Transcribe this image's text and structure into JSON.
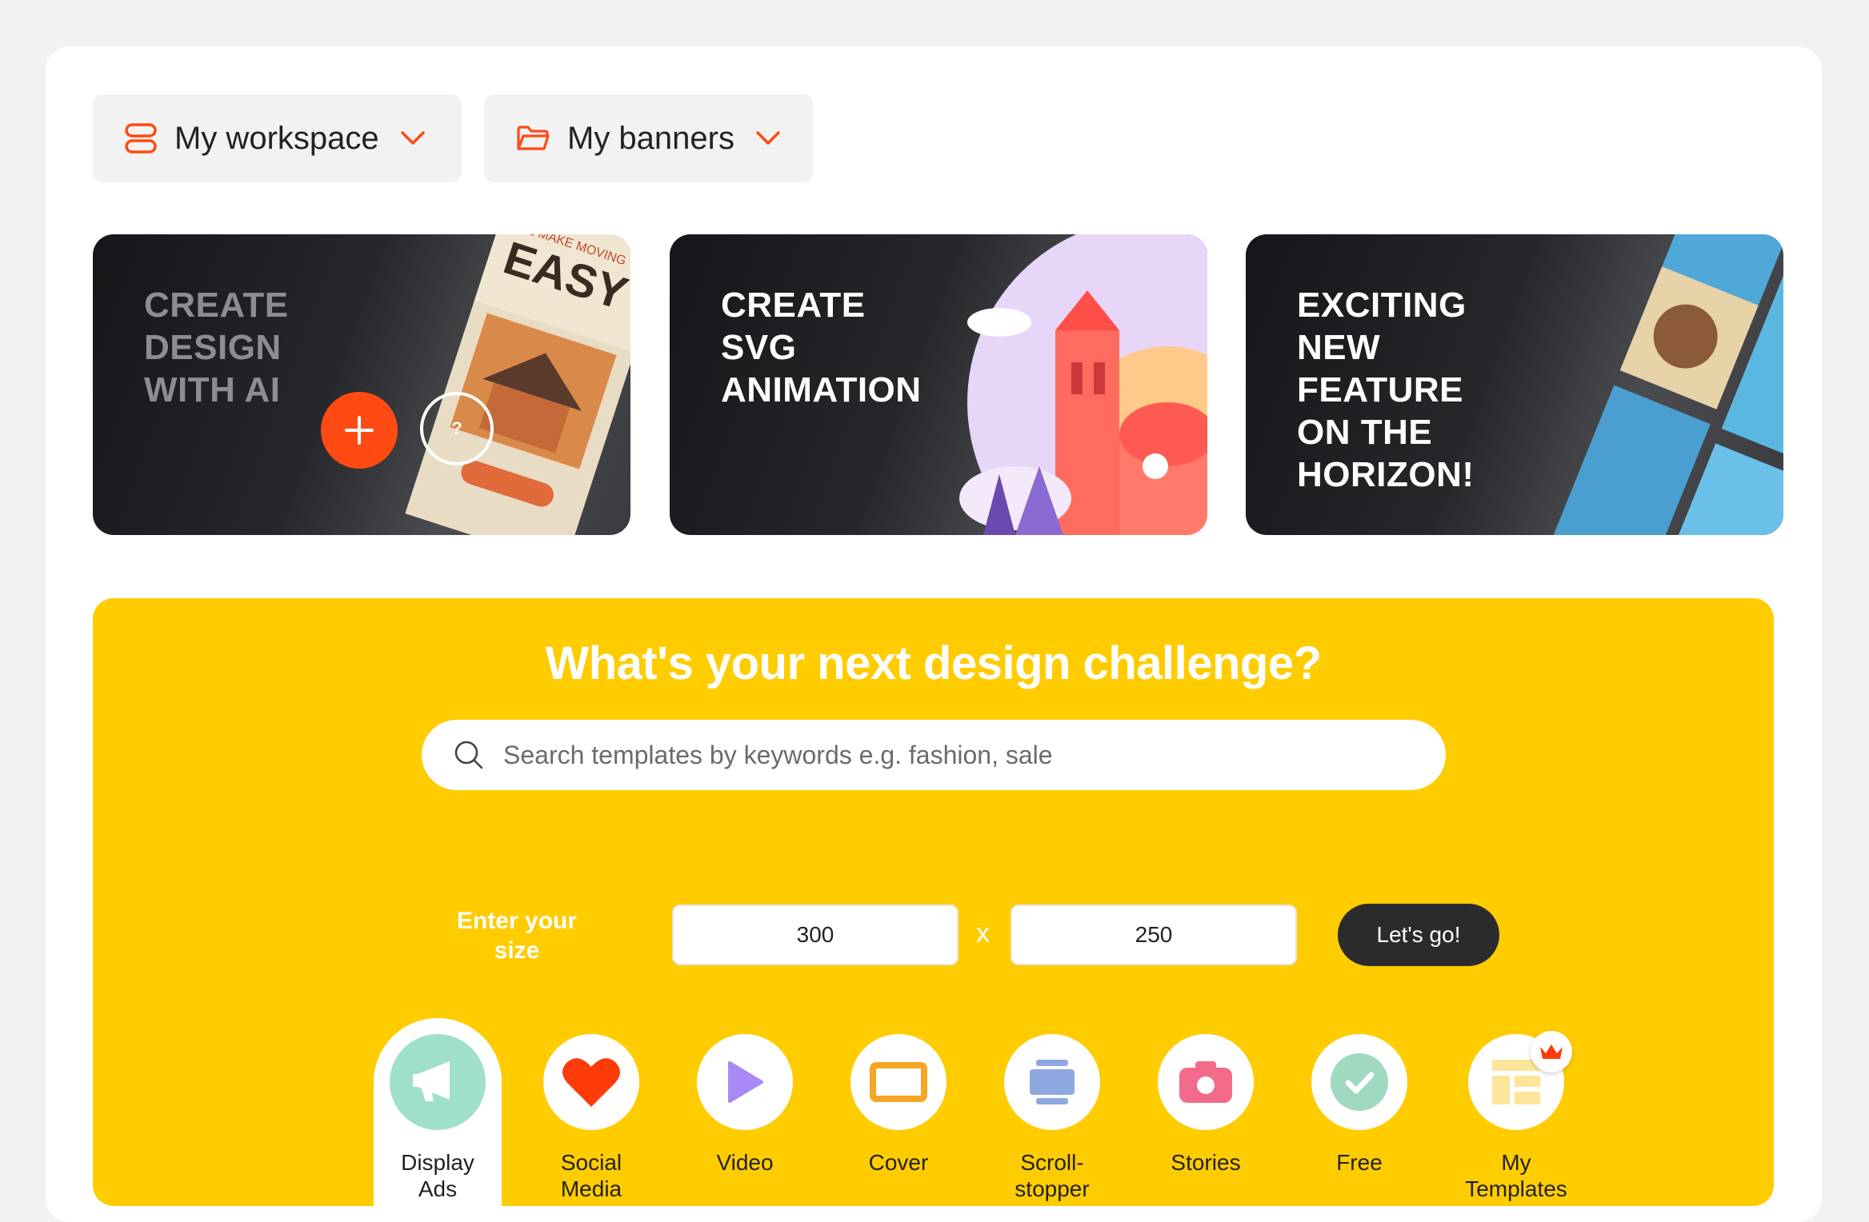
{
  "toolbar": {
    "workspace_label": "My workspace",
    "banners_label": "My banners"
  },
  "promos": [
    {
      "title_lines": [
        "CREATE",
        "DESIGN",
        "WITH AI"
      ],
      "help_label": "?"
    },
    {
      "title_lines": [
        "CREATE",
        "SVG",
        "ANIMATION"
      ]
    },
    {
      "title_lines": [
        "EXCITING",
        "NEW",
        "FEATURE",
        "ON THE",
        "HORIZON!"
      ]
    }
  ],
  "challenge": {
    "heading": "What's your next design challenge?",
    "search_placeholder": "Search templates by keywords e.g. fashion, sale",
    "size_label_line1": "Enter your",
    "size_label_line2": "size",
    "width_value": "300",
    "height_value": "250",
    "separator": "x",
    "go_label": "Let's go!"
  },
  "categories": [
    {
      "line1": "Display",
      "line2": "Ads",
      "icon": "megaphone-icon",
      "active": true
    },
    {
      "line1": "Social",
      "line2": "Media",
      "icon": "heart-icon"
    },
    {
      "line1": "Video",
      "line2": "",
      "icon": "play-icon"
    },
    {
      "line1": "Cover",
      "line2": "",
      "icon": "cover-frame-icon"
    },
    {
      "line1": "Scroll-",
      "line2": "stopper",
      "icon": "scroll-stopper-icon"
    },
    {
      "line1": "Stories",
      "line2": "",
      "icon": "camera-icon"
    },
    {
      "line1": "Free",
      "line2": "",
      "icon": "checkmark-icon"
    },
    {
      "line1": "My",
      "line2": "Templates",
      "icon": "templates-icon",
      "badge": "crown-icon"
    }
  ],
  "colors": {
    "accent": "#ff4a13",
    "challenge_bg": "#ffcc00",
    "dark_button": "#2b2b2e"
  }
}
